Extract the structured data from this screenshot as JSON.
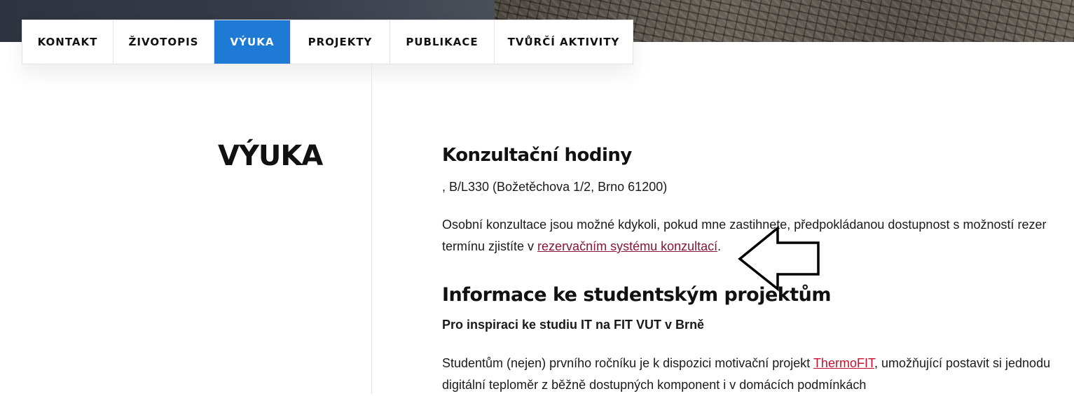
{
  "nav": {
    "tabs": [
      {
        "label": "KONTAKT"
      },
      {
        "label": "ŽIVOTOPIS"
      },
      {
        "label": "VÝUKA",
        "active": true
      },
      {
        "label": "PROJEKTY"
      },
      {
        "label": "PUBLIKACE"
      },
      {
        "label": "TVŮRČÍ AKTIVITY"
      }
    ]
  },
  "page_title": "VÝUKA",
  "consult": {
    "heading": "Konzultační hodiny",
    "location": ", B/L330 (Božetěchova 1/2, Brno 61200)",
    "text_line1": "Osobní konzultace jsou možné kdykoli, pokud  mne zastihnete, předpokládanou dostupnost s možností rezer",
    "text_line2_before": "termínu zjistíte v ",
    "text_line2_link": "rezervačním systému konzultací",
    "text_line2_after": "."
  },
  "projects": {
    "heading": "Informace ke studentským projektům",
    "subheading": "Pro inspiraci ke studiu IT na FIT VUT v Brně",
    "text_line1_before": "Studentům (nejen) prvního ročníku je k dispozici motivační projekt ",
    "text_line1_link": "ThermoFIT",
    "text_line1_after": ", umožňující postavit si jednodu",
    "text_line2": "digitální teploměr z běžně dostupných komponent i v domácích podmínkách"
  },
  "colors": {
    "accent": "#1f7ad6",
    "link": "#8a1538",
    "link_red": "#c8102e"
  },
  "annotation_icon": "left-arrow-outline-icon"
}
